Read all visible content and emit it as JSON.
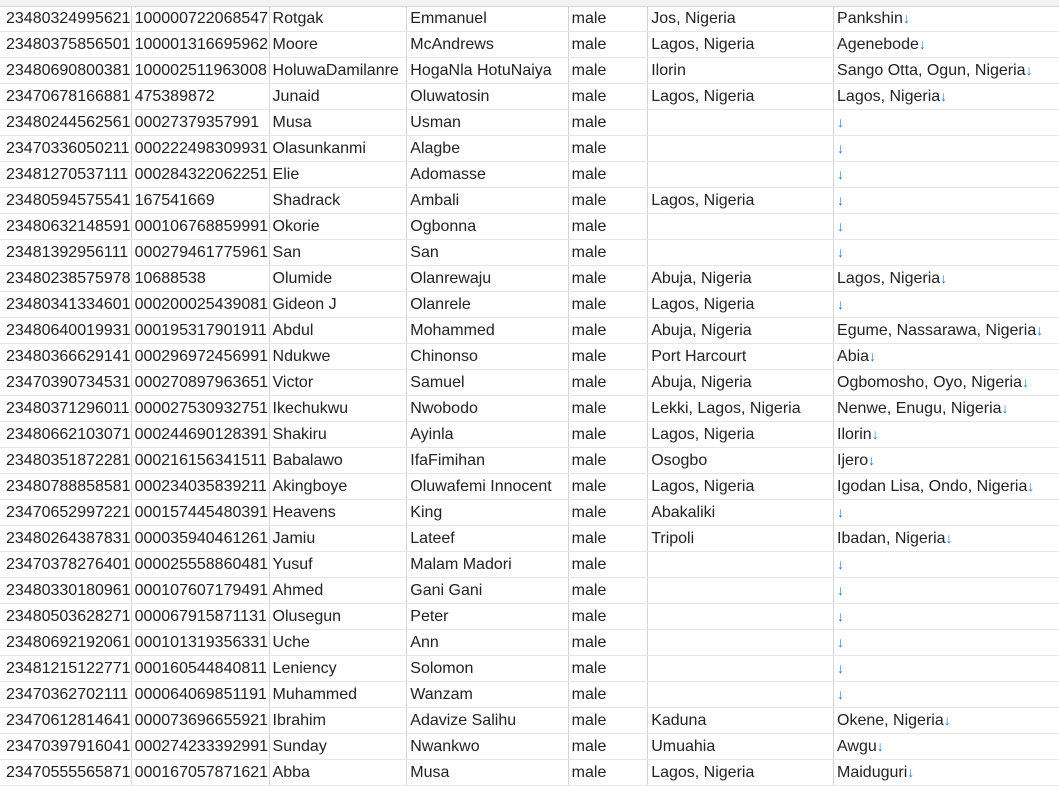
{
  "rows": [
    [
      "23480324995621",
      "100000722068547",
      "Rotgak",
      "Emmanuel",
      "male",
      "Jos, Nigeria",
      "Pankshin"
    ],
    [
      "23480375856501",
      "100001316695962",
      "Moore",
      "McAndrews",
      "male",
      "Lagos, Nigeria",
      "Agenebode"
    ],
    [
      "23480690800381",
      "100002511963008",
      "HoluwaDamilanre",
      "HogaNla HotuNaiya",
      "male",
      "Ilorin",
      "Sango Otta, Ogun, Nigeria"
    ],
    [
      "23470678166881",
      "475389872",
      "Junaid",
      "Oluwatosin",
      "male",
      "Lagos, Nigeria",
      "Lagos, Nigeria"
    ],
    [
      "23480244562561",
      "00027379357991",
      "Musa",
      "Usman",
      "male",
      "",
      ""
    ],
    [
      "23470336050211",
      "000222498309931",
      "Olasunkanmi",
      "Alagbe",
      "male",
      "",
      ""
    ],
    [
      "23481270537111",
      "000284322062251",
      "Elie",
      "Adomasse",
      "male",
      "",
      ""
    ],
    [
      "23480594575541",
      "167541669",
      "Shadrack",
      "Ambali",
      "male",
      "Lagos, Nigeria",
      ""
    ],
    [
      "23480632148591",
      "000106768859991",
      "Okorie",
      "Ogbonna",
      "male",
      "",
      ""
    ],
    [
      "23481392956111",
      "000279461775961",
      "San",
      "San",
      "male",
      "",
      ""
    ],
    [
      "23480238575978",
      "10688538",
      "Olumide",
      "Olanrewaju",
      "male",
      "Abuja, Nigeria",
      "Lagos, Nigeria"
    ],
    [
      "23480341334601",
      "000200025439081",
      "Gideon J",
      "Olanrele",
      "male",
      "Lagos, Nigeria",
      ""
    ],
    [
      "23480640019931",
      "000195317901911",
      "Abdul",
      "Mohammed",
      "male",
      "Abuja, Nigeria",
      "Egume, Nassarawa, Nigeria"
    ],
    [
      "23480366629141",
      "000296972456991",
      "Ndukwe",
      "Chinonso",
      "male",
      "Port Harcourt",
      "Abia"
    ],
    [
      "23470390734531",
      "000270897963651",
      "Victor",
      "Samuel",
      "male",
      "Abuja, Nigeria",
      "Ogbomosho, Oyo, Nigeria"
    ],
    [
      "23480371296011",
      "000027530932751",
      "Ikechukwu",
      "Nwobodo",
      "male",
      "Lekki, Lagos, Nigeria",
      "Nenwe, Enugu, Nigeria"
    ],
    [
      "23480662103071",
      "000244690128391",
      "Shakiru",
      "Ayinla",
      "male",
      "Lagos, Nigeria",
      "Ilorin"
    ],
    [
      "23480351872281",
      "000216156341511",
      "Babalawo",
      "IfaFimihan",
      "male",
      "Osogbo",
      "Ijero"
    ],
    [
      "23480788858581",
      "000234035839211",
      "Akingboye",
      "Oluwafemi Innocent",
      "male",
      "Lagos, Nigeria",
      "Igodan Lisa, Ondo, Nigeria"
    ],
    [
      "23470652997221",
      "000157445480391",
      "Heavens",
      "King",
      "male",
      "Abakaliki",
      ""
    ],
    [
      "23480264387831",
      "000035940461261",
      "Jamiu",
      "Lateef",
      "male",
      "Tripoli",
      "Ibadan, Nigeria"
    ],
    [
      "23470378276401",
      "000025558860481",
      "Yusuf",
      "Malam Madori",
      "male",
      "",
      ""
    ],
    [
      "23480330180961",
      "000107607179491",
      "Ahmed",
      "Gani Gani",
      "male",
      "",
      ""
    ],
    [
      "23480503628271",
      "000067915871131",
      "Olusegun",
      "Peter",
      "male",
      "",
      ""
    ],
    [
      "23480692192061",
      "000101319356331",
      "Uche",
      "Ann",
      "male",
      "",
      ""
    ],
    [
      "23481215122771",
      "000160544840811",
      "Leniency",
      "Solomon",
      "male",
      "",
      ""
    ],
    [
      "23470362702111",
      "000064069851191",
      "Muhammed",
      "Wanzam",
      "male",
      "",
      ""
    ],
    [
      "23470612814641",
      "000073696655921",
      "Ibrahim",
      "Adavize Salihu",
      "male",
      "Kaduna",
      "Okene, Nigeria"
    ],
    [
      "23470397916041",
      "000274233392991",
      "Sunday",
      "Nwankwo",
      "male",
      "Umuahia",
      "Awgu"
    ],
    [
      "23470555565871",
      "000167057871621",
      "Abba",
      "Musa",
      "male",
      "Lagos, Nigeria",
      "Maiduguri"
    ]
  ],
  "arrow_glyph": "↓"
}
